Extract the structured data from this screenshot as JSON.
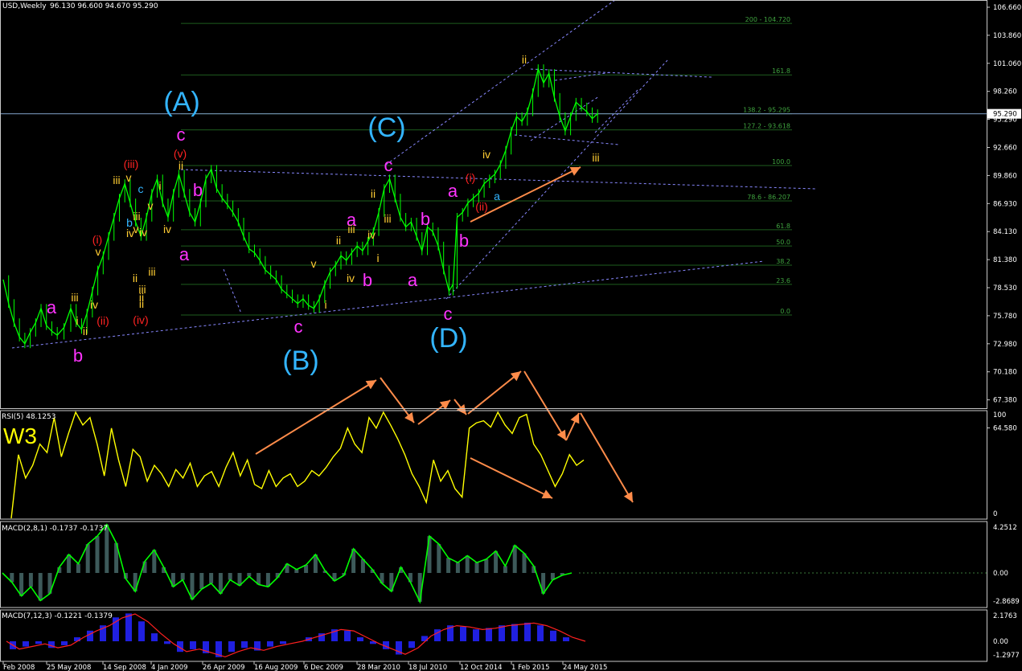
{
  "colors": {
    "background": "#000000",
    "price_bar": "#00ff00",
    "fib_line": "#1e5e1e",
    "fib_label": "#3fa33f",
    "trendline": "#8888ff",
    "current_price_line": "#7fa0c8",
    "rsi_line": "#ffff00",
    "macd_line": "#00ff00",
    "macd_hist": "#3d5a5a",
    "macd2_hist": "#2020e0",
    "macd2_signal": "#ff2020",
    "wave_magenta": "#ff33ff",
    "wave_cyan": "#33b5ff",
    "wave_red": "#ff2222",
    "wave_orange": "#ffcc33",
    "arrow": "#ff8c4a"
  },
  "header": {
    "symbol": "USD,Weekly",
    "ohlc": "96.130 96.600 94.670 95.290"
  },
  "indicators": {
    "rsi": {
      "label": "RSI(5) 48.1253",
      "ticks": [
        "100",
        "0"
      ]
    },
    "macd1": {
      "label": "MACD(2,8,1) -0.1737 -0.1737",
      "ticks": [
        "4.2512",
        "0.00",
        "-2.8689"
      ]
    },
    "macd2": {
      "label": "MACD(7,12,3) -0.1221 -0.1379",
      "ticks": [
        "2.1763",
        "0.00",
        "-1.2977"
      ]
    }
  },
  "annotation_w3": "W3",
  "chart_data": {
    "type": "line",
    "symbol": "USD",
    "timeframe": "Weekly",
    "price_axis": {
      "ticks": [
        "106.660",
        "103.860",
        "101.060",
        "98.260",
        "95.290",
        "92.660",
        "89.860",
        "86.930",
        "84.130",
        "81.380",
        "78.530",
        "75.780",
        "72.980",
        "70.180",
        "67.380",
        "64.580"
      ],
      "range": [
        64.58,
        106.66
      ],
      "current_price": "95.290"
    },
    "time_axis": [
      "Feb 2008",
      "25 May 2008",
      "14 Sep 2008",
      "4 Jan 2009",
      "26 Apr 2009",
      "16 Aug 2009",
      "6 Dec 2009",
      "28 Mar 2010",
      "18 Jul 2010",
      "12 Oct 2014",
      "1 Feb 2015",
      "24 May 2015"
    ],
    "price_series": [
      [
        0,
        78.0
      ],
      [
        4,
        75.5
      ],
      [
        8,
        73.5
      ],
      [
        12,
        72.0
      ],
      [
        16,
        71.3
      ],
      [
        20,
        72.5
      ],
      [
        24,
        73.5
      ],
      [
        28,
        75.0
      ],
      [
        32,
        73.2
      ],
      [
        36,
        72.6
      ],
      [
        40,
        72.2
      ],
      [
        45,
        73.0
      ],
      [
        50,
        75.0
      ],
      [
        54,
        73.5
      ],
      [
        58,
        72.8
      ],
      [
        62,
        74.5
      ],
      [
        66,
        76.8
      ],
      [
        70,
        79.0
      ],
      [
        74,
        80.5
      ],
      [
        78,
        82.5
      ],
      [
        82,
        84.5
      ],
      [
        86,
        86.5
      ],
      [
        90,
        88.0
      ],
      [
        94,
        86.0
      ],
      [
        98,
        84.0
      ],
      [
        102,
        82.5
      ],
      [
        106,
        84.5
      ],
      [
        110,
        87.0
      ],
      [
        114,
        88.5
      ],
      [
        118,
        86.0
      ],
      [
        122,
        84.5
      ],
      [
        126,
        87.0
      ],
      [
        130,
        89.0
      ],
      [
        134,
        87.0
      ],
      [
        138,
        85.0
      ],
      [
        142,
        84.0
      ],
      [
        146,
        86.0
      ],
      [
        150,
        88.5
      ],
      [
        154,
        89.5
      ],
      [
        158,
        87.5
      ],
      [
        162,
        86.5
      ],
      [
        166,
        85.8
      ],
      [
        170,
        85.0
      ],
      [
        174,
        84.0
      ],
      [
        178,
        82.5
      ],
      [
        182,
        81.2
      ],
      [
        186,
        80.8
      ],
      [
        190,
        80.0
      ],
      [
        194,
        79.0
      ],
      [
        198,
        78.5
      ],
      [
        202,
        78.0
      ],
      [
        206,
        77.0
      ],
      [
        210,
        76.5
      ],
      [
        214,
        76.0
      ],
      [
        218,
        75.5
      ],
      [
        222,
        76.0
      ],
      [
        226,
        75.3
      ],
      [
        230,
        75.0
      ],
      [
        234,
        76.0
      ],
      [
        238,
        77.5
      ],
      [
        242,
        78.8
      ],
      [
        246,
        79.5
      ],
      [
        250,
        80.5
      ],
      [
        254,
        80.0
      ],
      [
        258,
        80.8
      ],
      [
        262,
        81.5
      ],
      [
        266,
        81.0
      ],
      [
        270,
        82.0
      ],
      [
        274,
        83.0
      ],
      [
        278,
        85.0
      ],
      [
        282,
        87.5
      ],
      [
        286,
        88.5
      ],
      [
        290,
        86.5
      ],
      [
        294,
        84.5
      ],
      [
        298,
        83.5
      ],
      [
        302,
        84.0
      ],
      [
        306,
        82.5
      ],
      [
        310,
        81.0
      ],
      [
        314,
        83.5
      ],
      [
        318,
        83.0
      ],
      [
        322,
        81.5
      ],
      [
        326,
        79.0
      ],
      [
        330,
        76.8
      ],
      [
        333,
        77.5
      ],
      [
        336,
        84.5
      ],
      [
        340,
        85.0
      ],
      [
        344,
        86.0
      ],
      [
        348,
        86.5
      ],
      [
        352,
        87.0
      ],
      [
        356,
        88.0
      ],
      [
        360,
        88.5
      ],
      [
        364,
        89.0
      ],
      [
        368,
        90.0
      ],
      [
        372,
        91.5
      ],
      [
        376,
        93.5
      ],
      [
        380,
        95.0
      ],
      [
        384,
        94.5
      ],
      [
        388,
        95.5
      ],
      [
        392,
        97.5
      ],
      [
        396,
        100.0
      ],
      [
        400,
        98.5
      ],
      [
        404,
        99.5
      ],
      [
        408,
        97.0
      ],
      [
        412,
        95.0
      ],
      [
        416,
        93.5
      ],
      [
        420,
        95.0
      ],
      [
        424,
        96.5
      ],
      [
        428,
        96.0
      ],
      [
        432,
        95.5
      ],
      [
        436,
        94.8
      ],
      [
        440,
        95.3
      ]
    ],
    "fib_levels": [
      {
        "label": "200 - 104.720",
        "value": 104.72
      },
      {
        "label": "161.8",
        "value": 99.35
      },
      {
        "label": "138.2 - 95.295",
        "value": 95.295
      },
      {
        "label": "127.2 - 93.618",
        "value": 93.618
      },
      {
        "label": "100.0",
        "value": 89.9
      },
      {
        "label": "78.6 - 86.207",
        "value": 86.207
      },
      {
        "label": "61.8",
        "value": 83.2
      },
      {
        "label": "50.0",
        "value": 81.5
      },
      {
        "label": "38.2",
        "value": 79.5
      },
      {
        "label": "23.6",
        "value": 77.5
      },
      {
        "label": "0.0",
        "value": 74.3
      }
    ],
    "wave_labels": [
      {
        "text": "(A)",
        "color": "cyan",
        "size": "lg"
      },
      {
        "text": "(B)",
        "color": "cyan",
        "size": "lg"
      },
      {
        "text": "(C)",
        "color": "cyan",
        "size": "lg"
      },
      {
        "text": "(D)",
        "color": "cyan",
        "size": "lg"
      },
      {
        "text": "c",
        "color": "magenta",
        "size": "md"
      },
      {
        "text": "c",
        "color": "magenta",
        "size": "md"
      },
      {
        "text": "c",
        "color": "magenta",
        "size": "md"
      },
      {
        "text": "c",
        "color": "magenta",
        "size": "md"
      },
      {
        "text": "a",
        "color": "magenta",
        "size": "md"
      },
      {
        "text": "b",
        "color": "magenta",
        "size": "md"
      },
      {
        "text": "a",
        "color": "magenta",
        "size": "md"
      },
      {
        "text": "b",
        "color": "magenta",
        "size": "md"
      },
      {
        "text": "a",
        "color": "magenta",
        "size": "md"
      },
      {
        "text": "b",
        "color": "magenta",
        "size": "md"
      },
      {
        "text": "a",
        "color": "magenta",
        "size": "md"
      },
      {
        "text": "b",
        "color": "magenta",
        "size": "md"
      },
      {
        "text": "a",
        "color": "magenta",
        "size": "md"
      },
      {
        "text": "b",
        "color": "magenta",
        "size": "md"
      },
      {
        "text": "(v)",
        "color": "red",
        "size": "sm"
      },
      {
        "text": "(iii)",
        "color": "red",
        "size": "sm"
      },
      {
        "text": "(i)",
        "color": "red",
        "size": "sm"
      },
      {
        "text": "(ii)",
        "color": "red",
        "size": "sm"
      },
      {
        "text": "(iv)",
        "color": "red",
        "size": "sm"
      },
      {
        "text": "(i)",
        "color": "red",
        "size": "sm"
      },
      {
        "text": "(ii)",
        "color": "red",
        "size": "sm"
      },
      {
        "text": "iii",
        "color": "orange",
        "size": "sm"
      },
      {
        "text": "iv",
        "color": "orange",
        "size": "sm"
      },
      {
        "text": "i",
        "color": "orange",
        "size": "sm"
      },
      {
        "text": "ii",
        "color": "orange",
        "size": "sm"
      },
      {
        "text": "v",
        "color": "orange",
        "size": "sm"
      },
      {
        "text": "iii",
        "color": "orange",
        "size": "sm"
      },
      {
        "text": "v",
        "color": "orange",
        "size": "sm"
      },
      {
        "text": "iv",
        "color": "orange",
        "size": "sm"
      },
      {
        "text": "ii",
        "color": "orange",
        "size": "sm"
      },
      {
        "text": "iii",
        "color": "orange",
        "size": "sm"
      },
      {
        "text": "ii",
        "color": "orange",
        "size": "sm"
      },
      {
        "text": "v",
        "color": "orange",
        "size": "sm"
      },
      {
        "text": "iii",
        "color": "orange",
        "size": "sm"
      },
      {
        "text": "iv",
        "color": "orange",
        "size": "sm"
      },
      {
        "text": "v",
        "color": "orange",
        "size": "sm"
      },
      {
        "text": "i",
        "color": "orange",
        "size": "sm"
      },
      {
        "text": "iv",
        "color": "orange",
        "size": "sm"
      },
      {
        "text": "ii",
        "color": "orange",
        "size": "sm"
      },
      {
        "text": "iii",
        "color": "orange",
        "size": "sm"
      },
      {
        "text": "iv",
        "color": "orange",
        "size": "sm"
      },
      {
        "text": "v",
        "color": "orange",
        "size": "sm"
      },
      {
        "text": "i",
        "color": "orange",
        "size": "sm"
      },
      {
        "text": "ii",
        "color": "orange",
        "size": "sm"
      },
      {
        "text": "iii",
        "color": "orange",
        "size": "sm"
      },
      {
        "text": "ii",
        "color": "orange",
        "size": "sm"
      },
      {
        "text": "iii",
        "color": "orange",
        "size": "sm"
      },
      {
        "text": "iv",
        "color": "orange",
        "size": "sm"
      },
      {
        "text": "i",
        "color": "orange",
        "size": "sm"
      },
      {
        "text": "ii",
        "color": "orange",
        "size": "sm"
      },
      {
        "text": "iii",
        "color": "orange",
        "size": "sm"
      },
      {
        "text": "iv",
        "color": "orange",
        "size": "sm"
      },
      {
        "text": "a",
        "color": "cyan",
        "size": "sm"
      },
      {
        "text": "b",
        "color": "cyan",
        "size": "sm"
      },
      {
        "text": "c",
        "color": "cyan",
        "size": "sm"
      },
      {
        "text": "ii",
        "color": "orange",
        "size": "sm"
      }
    ]
  }
}
